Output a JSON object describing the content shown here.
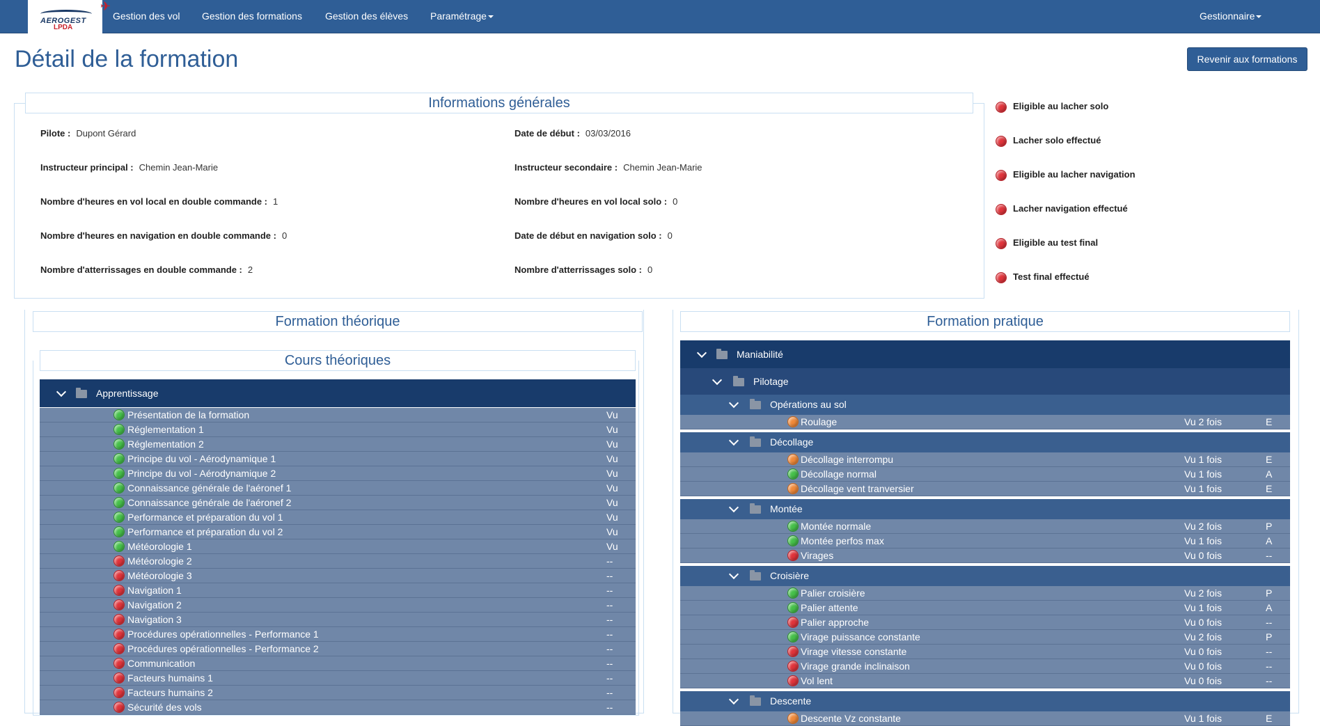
{
  "nav": {
    "logo_text": "AEROGEST",
    "logo_sub": "LPDA",
    "items": [
      "Gestion des vol",
      "Gestion des formations",
      "Gestion des élèves",
      "Paramétrage"
    ],
    "user": "Gestionnaire"
  },
  "header": {
    "title": "Détail de la formation",
    "back_button": "Revenir aux formations"
  },
  "general": {
    "heading": "Informations générales",
    "fields": [
      {
        "label": "Pilote :",
        "value": "Dupont Gérard"
      },
      {
        "label": "Date de début :",
        "value": "03/03/2016"
      },
      {
        "label": "Instructeur principal :",
        "value": "Chemin Jean-Marie"
      },
      {
        "label": "Instructeur secondaire :",
        "value": "Chemin Jean-Marie"
      },
      {
        "label": "Nombre d'heures en vol local en double commande :",
        "value": "1"
      },
      {
        "label": "Nombre d'heures en vol local solo :",
        "value": "0"
      },
      {
        "label": "Nombre d'heures en navigation en double commande :",
        "value": "0"
      },
      {
        "label": "Date de début en navigation solo :",
        "value": "0"
      },
      {
        "label": "Nombre d'atterrissages en double commande :",
        "value": "2"
      },
      {
        "label": "Nombre d'atterrissages solo :",
        "value": "0"
      }
    ]
  },
  "status_list": [
    {
      "label": "Eligible au lacher solo",
      "state": "red"
    },
    {
      "label": "Lacher solo effectué",
      "state": "red"
    },
    {
      "label": "Eligible au lacher navigation",
      "state": "red"
    },
    {
      "label": "Lacher navigation effectué",
      "state": "red"
    },
    {
      "label": "Eligible au test final",
      "state": "red"
    },
    {
      "label": "Test final effectué",
      "state": "red"
    }
  ],
  "theory": {
    "heading": "Formation théorique",
    "subheading": "Cours théoriques",
    "group": "Apprentissage",
    "courses": [
      {
        "label": "Présentation de la formation",
        "status": "Vu",
        "state": "green"
      },
      {
        "label": "Réglementation 1",
        "status": "Vu",
        "state": "green"
      },
      {
        "label": "Réglementation 2",
        "status": "Vu",
        "state": "green"
      },
      {
        "label": "Principe du vol - Aérodynamique 1",
        "status": "Vu",
        "state": "green"
      },
      {
        "label": "Principe du vol - Aérodynamique 2",
        "status": "Vu",
        "state": "green"
      },
      {
        "label": "Connaissance générale de l'aéronef 1",
        "status": "Vu",
        "state": "green"
      },
      {
        "label": "Connaissance générale de l'aéronef 2",
        "status": "Vu",
        "state": "green"
      },
      {
        "label": "Performance et préparation du vol 1",
        "status": "Vu",
        "state": "green"
      },
      {
        "label": "Performance et préparation du vol 2",
        "status": "Vu",
        "state": "green"
      },
      {
        "label": "Météorologie 1",
        "status": "Vu",
        "state": "green"
      },
      {
        "label": "Météorologie 2",
        "status": "--",
        "state": "red"
      },
      {
        "label": "Météorologie 3",
        "status": "--",
        "state": "red"
      },
      {
        "label": "Navigation 1",
        "status": "--",
        "state": "red"
      },
      {
        "label": "Navigation 2",
        "status": "--",
        "state": "red"
      },
      {
        "label": "Navigation 3",
        "status": "--",
        "state": "red"
      },
      {
        "label": "Procédures opérationnelles - Performance 1",
        "status": "--",
        "state": "red"
      },
      {
        "label": "Procédures opérationnelles - Performance 2",
        "status": "--",
        "state": "red"
      },
      {
        "label": "Communication",
        "status": "--",
        "state": "red"
      },
      {
        "label": "Facteurs humains 1",
        "status": "--",
        "state": "red"
      },
      {
        "label": "Facteurs humains 2",
        "status": "--",
        "state": "red"
      },
      {
        "label": "Sécurité des vols",
        "status": "--",
        "state": "red"
      }
    ]
  },
  "practice": {
    "heading": "Formation pratique",
    "group": "Maniabilité",
    "subgroup": "Pilotage",
    "sections": [
      {
        "name": "Opérations au sol",
        "items": [
          {
            "label": "Roulage",
            "count": "Vu 2 fois",
            "level": "E",
            "state": "orange"
          }
        ]
      },
      {
        "name": "Décollage",
        "items": [
          {
            "label": "Décollage interrompu",
            "count": "Vu 1 fois",
            "level": "E",
            "state": "orange"
          },
          {
            "label": "Décollage normal",
            "count": "Vu 1 fois",
            "level": "A",
            "state": "green"
          },
          {
            "label": "Décollage vent tranversier",
            "count": "Vu 1 fois",
            "level": "E",
            "state": "orange"
          }
        ]
      },
      {
        "name": "Montée",
        "items": [
          {
            "label": "Montée normale",
            "count": "Vu 2 fois",
            "level": "P",
            "state": "green"
          },
          {
            "label": "Montée perfos max",
            "count": "Vu 1 fois",
            "level": "A",
            "state": "green"
          },
          {
            "label": "Virages",
            "count": "Vu 0 fois",
            "level": "--",
            "state": "red"
          }
        ]
      },
      {
        "name": "Croisière",
        "items": [
          {
            "label": "Palier croisière",
            "count": "Vu 2 fois",
            "level": "P",
            "state": "green"
          },
          {
            "label": "Palier attente",
            "count": "Vu 1 fois",
            "level": "A",
            "state": "green"
          },
          {
            "label": "Palier approche",
            "count": "Vu 0 fois",
            "level": "--",
            "state": "red"
          },
          {
            "label": "Virage puissance constante",
            "count": "Vu 2 fois",
            "level": "P",
            "state": "green"
          },
          {
            "label": "Virage vitesse constante",
            "count": "Vu 0 fois",
            "level": "--",
            "state": "red"
          },
          {
            "label": "Virage grande inclinaison",
            "count": "Vu 0 fois",
            "level": "--",
            "state": "red"
          },
          {
            "label": "Vol lent",
            "count": "Vu 0 fois",
            "level": "--",
            "state": "red"
          }
        ]
      },
      {
        "name": "Descente",
        "items": [
          {
            "label": "Descente Vz constante",
            "count": "Vu 1 fois",
            "level": "E",
            "state": "orange"
          }
        ]
      }
    ]
  }
}
